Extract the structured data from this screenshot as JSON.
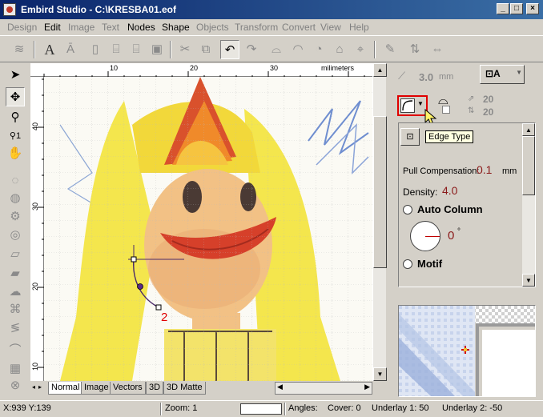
{
  "window": {
    "title": "Embird Studio - C:\\KRESBA01.eof",
    "minimize": "_",
    "maximize": "□",
    "close": "×"
  },
  "menu": [
    {
      "label": "Design",
      "enabled": false
    },
    {
      "label": "Edit",
      "enabled": true
    },
    {
      "label": "Image",
      "enabled": false
    },
    {
      "label": "Text",
      "enabled": false
    },
    {
      "label": "Nodes",
      "enabled": true
    },
    {
      "label": "Shape",
      "enabled": true
    },
    {
      "label": "Objects",
      "enabled": false
    },
    {
      "label": "Transform",
      "enabled": false
    },
    {
      "label": "Convert",
      "enabled": false
    },
    {
      "label": "View",
      "enabled": false
    },
    {
      "label": "Help",
      "enabled": false
    }
  ],
  "ruler": {
    "unit": "milimeters",
    "top_ticks": [
      "10",
      "20",
      "30"
    ],
    "left_ticks": [
      "40",
      "30",
      "20",
      "10"
    ]
  },
  "canvas": {
    "node_label": "2"
  },
  "tabs": [
    "Normal",
    "Image",
    "Vectors",
    "3D",
    "3D Matte"
  ],
  "right_panel": {
    "width_value": "3.0",
    "width_unit": "mm",
    "spacing_h": "20",
    "spacing_v": "20",
    "tooltip": "Edge Type",
    "pull_comp_label": "Pull Compensation:",
    "pull_comp_value": "0.1",
    "pull_comp_unit": "mm",
    "density_label": "Density:",
    "density_value": "4.0",
    "auto_column_label": "Auto Column",
    "angle_value": "0",
    "angle_unit": "°",
    "motif_label": "Motif"
  },
  "status": {
    "coords": "X:939  Y:139",
    "zoom": "Zoom: 1",
    "angles": "Angles:",
    "cover": "Cover: 0",
    "underlay1": "Underlay 1: 50",
    "underlay2": "Underlay 2: -50"
  },
  "colors": {
    "title_start": "#0a246a",
    "title_end": "#3a6ea5",
    "accent_red": "#e00000",
    "value_red": "#8b1a1a"
  }
}
